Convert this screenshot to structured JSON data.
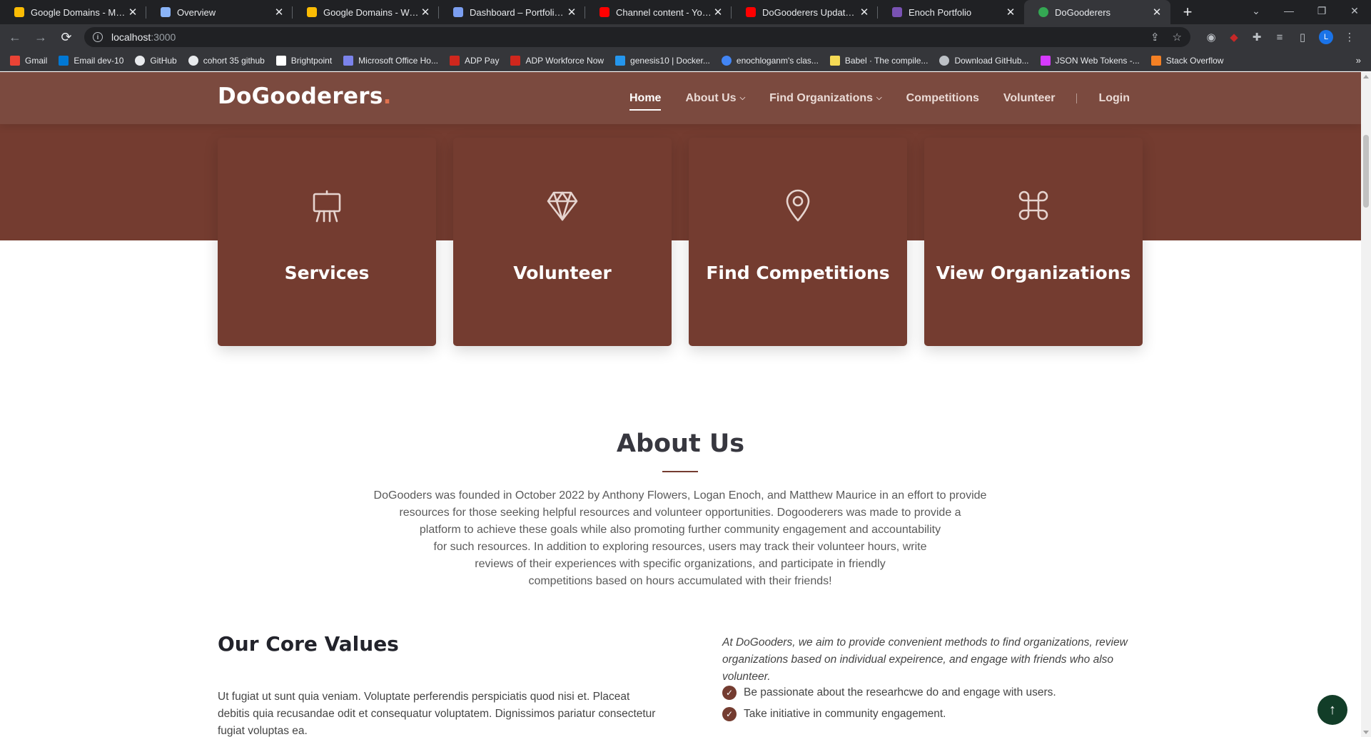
{
  "browser": {
    "tabs": [
      {
        "title": "Google Domains - My don",
        "icon_color": "#fbbc04",
        "active": false
      },
      {
        "title": "Overview",
        "icon_color": "#8ab4f8",
        "active": false
      },
      {
        "title": "Google Domains - Website",
        "icon_color": "#fbbc04",
        "active": false
      },
      {
        "title": "Dashboard – Portfolio – Go",
        "icon_color": "#7b9ef0",
        "active": false
      },
      {
        "title": "Channel content - YouTube",
        "icon_color": "#ff0000",
        "active": false
      },
      {
        "title": "DoGooderers Updated - Yo",
        "icon_color": "#ff0000",
        "active": false
      },
      {
        "title": "Enoch Portfolio",
        "icon_color": "#7952b3",
        "active": false
      },
      {
        "title": "DoGooderers",
        "icon_color": "#34a853",
        "active": true
      }
    ],
    "new_tab_label": "+",
    "url_host": "localhost",
    "url_port": ":3000",
    "profile_initial": "L",
    "bookmarks": [
      {
        "label": "Gmail",
        "icon_color": "#ea4335"
      },
      {
        "label": "Email dev-10",
        "icon_color": "#0078d4"
      },
      {
        "label": "GitHub",
        "icon_color": "#e8eaed"
      },
      {
        "label": "cohort 35 github",
        "icon_color": "#e8eaed"
      },
      {
        "label": "Brightpoint",
        "icon_color": "#ffffff"
      },
      {
        "label": "Microsoft Office Ho...",
        "icon_color": "#7b83eb"
      },
      {
        "label": "ADP Pay",
        "icon_color": "#d0271d"
      },
      {
        "label": "ADP Workforce Now",
        "icon_color": "#d0271d"
      },
      {
        "label": "genesis10 | Docker...",
        "icon_color": "#2496ed"
      },
      {
        "label": "enochloganm's clas...",
        "icon_color": "#4285f4"
      },
      {
        "label": "Babel · The compile...",
        "icon_color": "#f5da55"
      },
      {
        "label": "Download GitHub...",
        "icon_color": "#bdc1c6"
      },
      {
        "label": "JSON Web Tokens -...",
        "icon_color": "#d63aff"
      },
      {
        "label": "Stack Overflow",
        "icon_color": "#f48024"
      }
    ]
  },
  "site": {
    "logo_text": "DoGooderers",
    "logo_dot": ".",
    "nav": {
      "home": "Home",
      "about": "About Us",
      "find_orgs": "Find Organizations",
      "competitions": "Competitions",
      "volunteer": "Volunteer",
      "login": "Login"
    },
    "features": [
      {
        "title": "Services",
        "icon": "easel-icon"
      },
      {
        "title": "Volunteer",
        "icon": "gem-icon"
      },
      {
        "title": "Find Competitions",
        "icon": "map-pin-icon"
      },
      {
        "title": "View Organizations",
        "icon": "command-icon"
      }
    ],
    "about": {
      "title": "About Us",
      "lines": [
        "DoGooders was founded in October 2022 by Anthony Flowers, Logan Enoch, and Matthew Maurice in an effort to provide",
        "resources for those seeking helpful resources and volunteer opportunities. Dogooderers was made to provide a",
        "platform to achieve these goals while also promoting further community engagement and accountability",
        "for such resources. In addition to exploring resources, users may track their volunteer hours, write",
        "reviews of their experiences with specific organizations, and participate in friendly",
        "competitions based on hours accumulated with their friends!"
      ]
    },
    "core_values": {
      "title": "Our Core Values",
      "text_lines": [
        "Ut fugiat ut sunt quia veniam. Voluptate perferendis perspiciatis quod nisi et. Placeat",
        "debitis quia recusandae odit et consequatur voluptatem. Dignissimos pariatur consectetur",
        "fugiat voluptas ea."
      ],
      "intro_lines": [
        "At DoGooders, we aim to provide convenient methods to find organizations, review",
        "organizations based on individual expeirence, and engage with friends who also",
        "volunteer."
      ],
      "checklist": [
        "Be passionate about the researhcwe do and engage with users.",
        "Take initiative in community engagement."
      ]
    },
    "back_to_top_icon": "arrow-up-icon"
  },
  "colors": {
    "brand_dark": "#743c30",
    "header_bg": "#7b4a3f",
    "logo_accent": "#e2734f",
    "back_to_top": "#123d28"
  }
}
